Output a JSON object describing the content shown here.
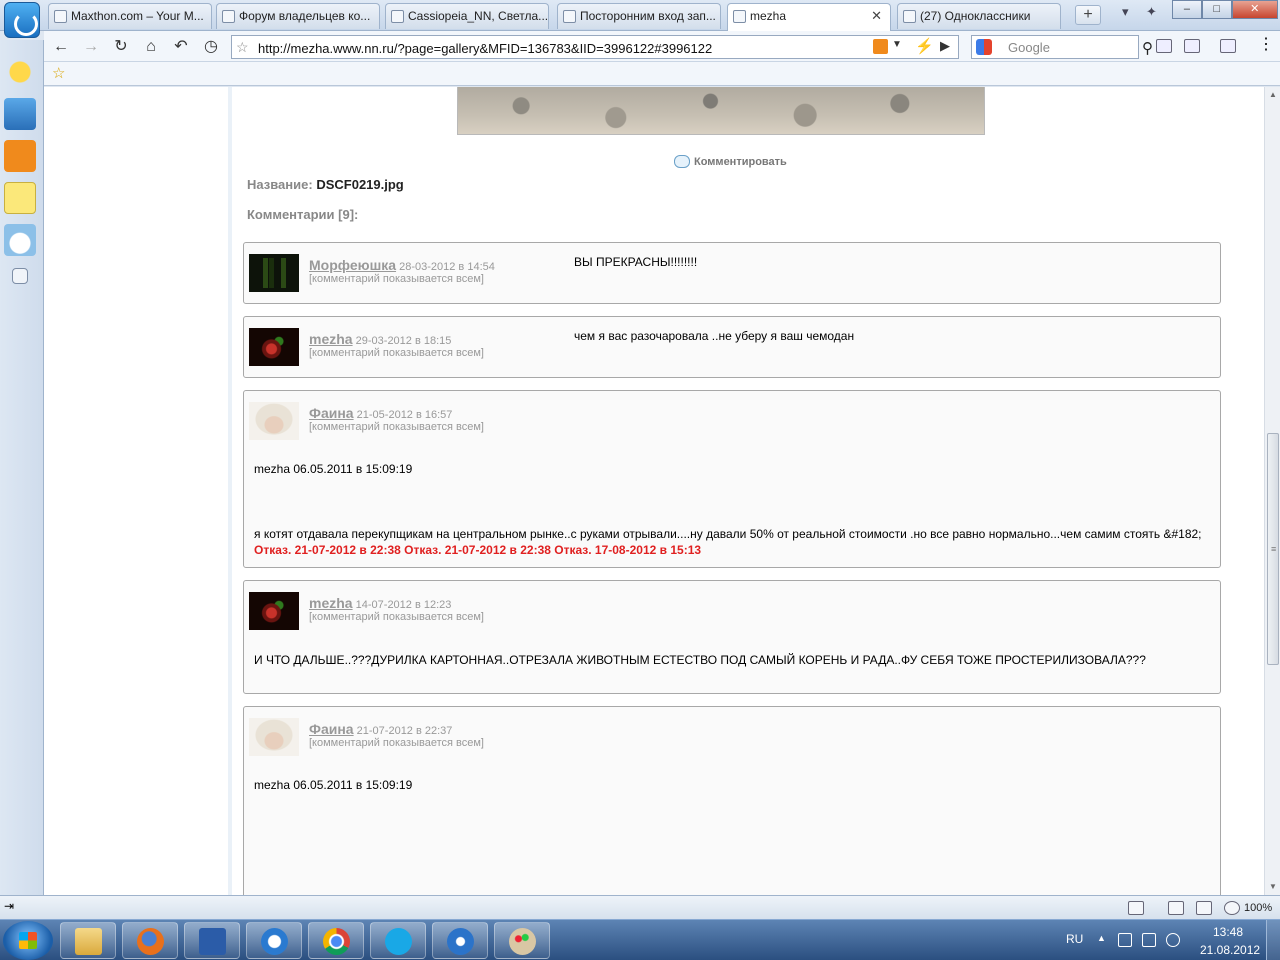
{
  "browser": {
    "tabs": [
      {
        "label": "Maxthon.com – Your M..."
      },
      {
        "label": "Форум владельцев ко..."
      },
      {
        "label": "Cassiopeia_NN, Светла..."
      },
      {
        "label": "Посторонним вход зап..."
      },
      {
        "label": "mezha",
        "active": true
      },
      {
        "label": "(27) Одноклассники"
      }
    ],
    "new_tab_icon": "plus-icon",
    "url": "http://mezha.www.nn.ru/?page=gallery&MFID=136783&IID=3996122#3996122",
    "search_placeholder": "Google"
  },
  "page": {
    "comment_action": "Комментировать",
    "name_label": "Название:",
    "file_name": "DSCF0219.jpg",
    "comments_heading": "Комментарии [9]:",
    "comments": [
      {
        "author": "Морфеюшка",
        "date": "28-03-2012 в 14:54",
        "visibility": "[комментарий показывается всем]",
        "text": "ВЫ ПРЕКРАСНЫ!!!!!!!!"
      },
      {
        "author": "mezha",
        "date": "29-03-2012 в 18:15",
        "visibility": "[комментарий показывается всем]",
        "text": "чем я вас разочаровала ..не уберу я ваш чемодан"
      },
      {
        "author": "Фаина",
        "date": "21-05-2012 в 16:57",
        "visibility": "[комментарий показывается всем]",
        "quote": "mezha 06.05.2011 в 15:09:19",
        "text": "я котят отдавала перекупщикам на центральном рынке..с руками отрывали....ну давали 50% от реальной стоимости .но все равно нормально...чем самим стоять &#182;",
        "refusal": "Отказ. 21-07-2012 в 22:38 Отказ. 21-07-2012 в 22:38 Отказ. 17-08-2012 в 15:13"
      },
      {
        "author": "mezha",
        "date": "14-07-2012 в 12:23",
        "visibility": "[комментарий показывается всем]",
        "text": "И ЧТО ДАЛЬШЕ..???ДУРИЛКА КАРТОННАЯ..ОТРЕЗАЛА ЖИВОТНЫМ ЕСТЕСТВО ПОД САМЫЙ КОРЕНЬ И РАДА..ФУ СЕБЯ ТОЖЕ ПРОСТЕРИЛИЗОВАЛА???"
      },
      {
        "author": "Фаина",
        "date": "21-07-2012 в 22:37",
        "visibility": "[комментарий показывается всем]",
        "quote": "mezha 06.05.2011 в 15:09:19"
      }
    ]
  },
  "statusbar": {
    "zoom": "100%"
  },
  "taskbar": {
    "apps": [
      "file-explorer-icon",
      "firefox-icon",
      "word-icon",
      "maxthon-icon",
      "chrome-icon",
      "skype-icon",
      "download-icon",
      "paint-icon"
    ],
    "language": "RU",
    "time": "13:48",
    "date": "21.08.2012"
  }
}
